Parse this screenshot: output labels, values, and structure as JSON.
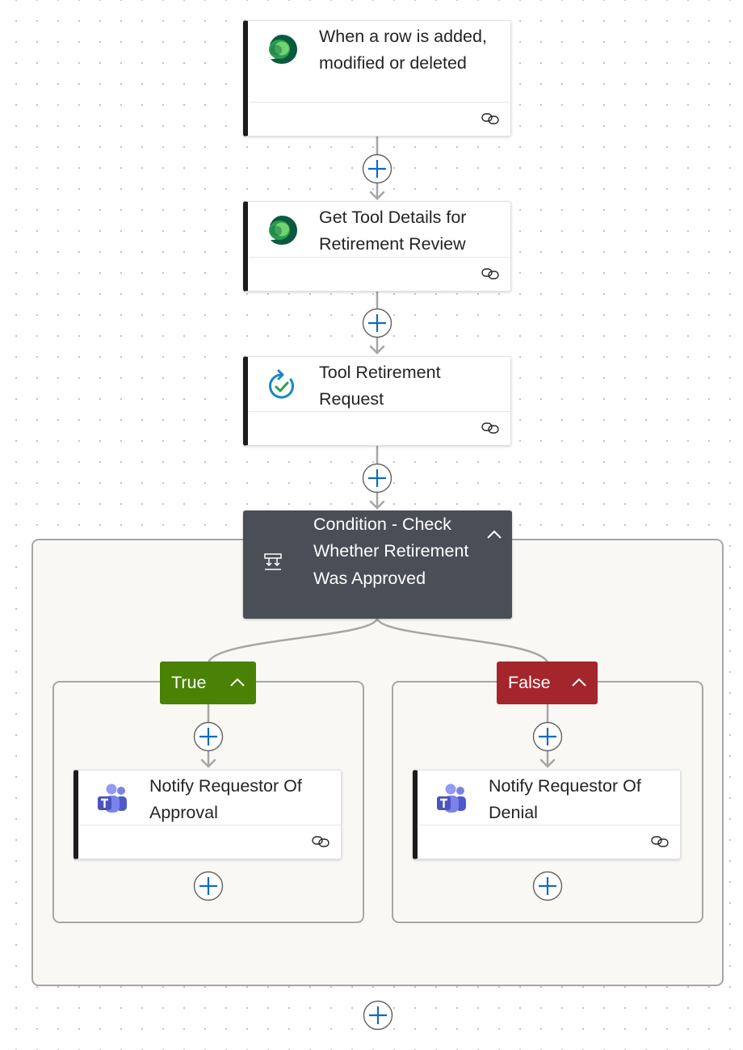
{
  "flow": {
    "trigger": {
      "title": "When a row is added, modified or deleted",
      "icon": "dataverse-icon",
      "footer_icon": "link-icon"
    },
    "step_get_tool": {
      "title": "Get Tool Details for Retirement Review",
      "icon": "dataverse-icon",
      "footer_icon": "link-icon"
    },
    "step_approval": {
      "title": "Tool Retirement Request",
      "icon": "approvals-icon",
      "footer_icon": "link-icon"
    },
    "condition": {
      "title": "Condition - Check Whether Retirement Was Approved",
      "icon": "condition-icon",
      "collapse_icon": "chevron-up-icon",
      "branches": {
        "true": {
          "label": "True",
          "color": "#498205",
          "action": {
            "title": "Notify Requestor Of Approval",
            "icon": "teams-icon",
            "footer_icon": "link-icon"
          }
        },
        "false": {
          "label": "False",
          "color": "#a4262c",
          "action": {
            "title": "Notify Requestor Of Denial",
            "icon": "teams-icon",
            "footer_icon": "link-icon"
          }
        }
      }
    },
    "add_step_icon": "plus-icon"
  },
  "colors": {
    "canvas": "#ffffff",
    "accent_blue": "#0f6cbd",
    "condition_header": "#4a4f57",
    "card_left_border": "#1c1c1c",
    "connector": "#a6a6a6"
  }
}
